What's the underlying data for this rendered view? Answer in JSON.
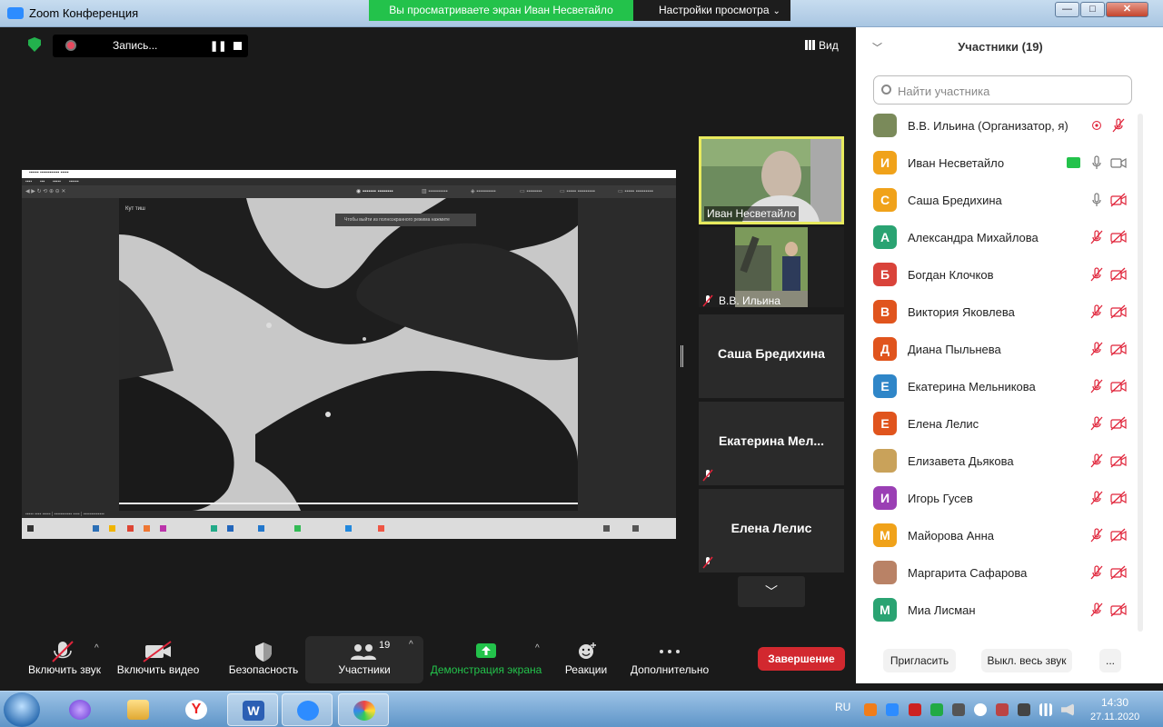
{
  "window": {
    "title": "Zoom Конференция",
    "share_banner": "Вы просматриваете экран Иван Несветайло",
    "view_settings": "Настройки просмотра"
  },
  "recording": {
    "label": "Запись..."
  },
  "view_button": {
    "label": "Вид"
  },
  "shared_screen": {
    "caption": "Кут тиш",
    "hint": "Чтобы выйти из полноэкранного режима нажмите"
  },
  "video_tiles": [
    {
      "name": "Иван Несветайло",
      "active_speaker": true
    },
    {
      "name": "В.В. Ильина",
      "muted": true
    },
    {
      "name": "Саша Бредихина"
    },
    {
      "name": "Екатерина  Мел...",
      "muted": true
    },
    {
      "name": "Елена Лелис",
      "muted": true
    }
  ],
  "toolbar": {
    "audio": "Включить звук",
    "video": "Включить видео",
    "security": "Безопасность",
    "participants": "Участники",
    "participants_count": "19",
    "share": "Демонстрация экрана",
    "reactions": "Реакции",
    "more": "Дополнительно",
    "end": "Завершение"
  },
  "panel": {
    "title": "Участники (19)",
    "search_placeholder": "Найти участника",
    "participants": [
      {
        "name": "В.В. Ильина (Организатор, я)",
        "initial": "",
        "color": "#7a8a5a",
        "photo": true,
        "mic": "off",
        "cam": "none"
      },
      {
        "name": "Иван Несветайло",
        "initial": "И",
        "color": "#f0a21a",
        "mic": "on",
        "cam": "on",
        "sharing": true
      },
      {
        "name": "Саша Бредихина",
        "initial": "С",
        "color": "#f0a21a",
        "mic": "on",
        "cam": "off"
      },
      {
        "name": "Александра Михайлова",
        "initial": "А",
        "color": "#2aa372",
        "mic": "off",
        "cam": "off"
      },
      {
        "name": "Богдан Клочков",
        "initial": "Б",
        "color": "#d9433a",
        "mic": "off",
        "cam": "off"
      },
      {
        "name": "Виктория Яковлева",
        "initial": "В",
        "color": "#e0541d",
        "mic": "off",
        "cam": "off"
      },
      {
        "name": "Диана Пыльнева",
        "initial": "Д",
        "color": "#e0541d",
        "mic": "off",
        "cam": "off"
      },
      {
        "name": "Екатерина Мельникова",
        "initial": "Е",
        "color": "#2f86c8",
        "mic": "off",
        "cam": "off"
      },
      {
        "name": "Елена Лелис",
        "initial": "Е",
        "color": "#e0541d",
        "mic": "off",
        "cam": "off"
      },
      {
        "name": "Елизавета Дьякова",
        "initial": "",
        "color": "#c9a25a",
        "photo": true,
        "mic": "off",
        "cam": "off"
      },
      {
        "name": "Игорь Гусев",
        "initial": "И",
        "color": "#9a3fb4",
        "mic": "off",
        "cam": "off"
      },
      {
        "name": "Майорова Анна",
        "initial": "М",
        "color": "#f0a21a",
        "mic": "off",
        "cam": "off"
      },
      {
        "name": "Маргарита Сафарова",
        "initial": "",
        "color": "#b98266",
        "photo": true,
        "mic": "off",
        "cam": "off"
      },
      {
        "name": "Миа Лисман",
        "initial": "М",
        "color": "#2aa372",
        "mic": "off",
        "cam": "off"
      }
    ],
    "invite": "Пригласить",
    "mute_all": "Выкл. весь звук",
    "more": "..."
  },
  "taskbar": {
    "lang": "RU",
    "time": "14:30",
    "date": "27.11.2020"
  },
  "colors": {
    "share_green": "#23c24b",
    "end_red": "#d2282f",
    "muted_red": "#e0243a",
    "speaker_yellow": "#e8ea5e"
  }
}
